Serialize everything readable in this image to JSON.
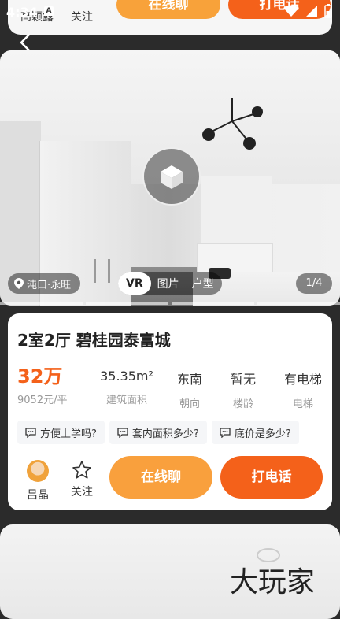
{
  "status_bar": {
    "time": "4:34"
  },
  "prev_card": {
    "agent_label": "高颖露",
    "follow_label": "关注",
    "chat_label": "在线聊",
    "call_label": "打电话"
  },
  "gallery": {
    "location": "沌口·永旺",
    "tabs": [
      "VR",
      "图片",
      "户型"
    ],
    "active_tab": "VR",
    "page_indicator": "1/4"
  },
  "listing": {
    "title": "2室2厅 碧桂园泰富城",
    "price": "32万",
    "unit_price": "9052元/平",
    "stats": [
      {
        "value": "35.35m²",
        "label": "建筑面积"
      },
      {
        "value": "东南",
        "label": "朝向"
      },
      {
        "value": "暂无",
        "label": "楼龄"
      },
      {
        "value": "有电梯",
        "label": "电梯"
      }
    ],
    "questions": [
      "方便上学吗?",
      "套内面积多少?",
      "底价是多少?"
    ]
  },
  "actions": {
    "agent_name": "吕晶",
    "follow_label": "关注",
    "chat_label": "在线聊",
    "call_label": "打电话"
  },
  "colors": {
    "primary_orange": "#f4611a",
    "light_orange": "#f9a03d",
    "price": "#f4611a"
  },
  "next_card": {
    "watermark": "大玩家"
  }
}
